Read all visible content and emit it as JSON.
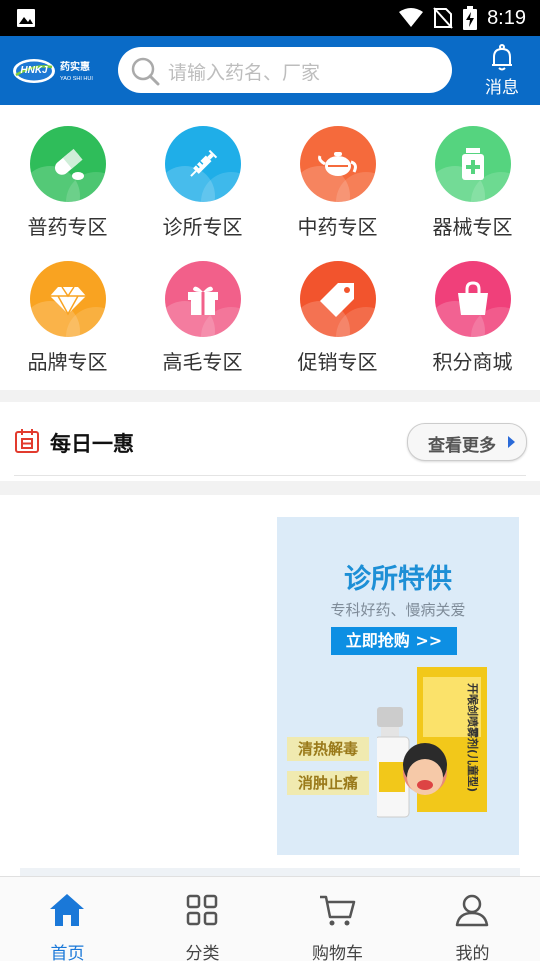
{
  "status_bar": {
    "time": "8:19",
    "icons": [
      "image-icon",
      "wifi-icon",
      "no-sim-icon",
      "battery-charging-icon"
    ]
  },
  "header": {
    "logo_text": "HNKJ",
    "logo_cn": "药实惠",
    "logo_en": "YAO SHI HUI",
    "search_placeholder": "请输入药名、厂家",
    "message_label": "消息",
    "accent_color": "#0a6bc7"
  },
  "categories": [
    {
      "label": "普药专区",
      "icon": "pill-icon",
      "color": "#2fbd5a"
    },
    {
      "label": "诊所专区",
      "icon": "syringe-icon",
      "color": "#1faee8"
    },
    {
      "label": "中药专区",
      "icon": "teapot-icon",
      "color": "#f56a3c"
    },
    {
      "label": "器械专区",
      "icon": "medicine-bottle-icon",
      "color": "#55d47f"
    },
    {
      "label": "品牌专区",
      "icon": "diamond-icon",
      "color": "#f9a321"
    },
    {
      "label": "高毛专区",
      "icon": "gift-icon",
      "color": "#f2608a"
    },
    {
      "label": "促销专区",
      "icon": "price-tag-icon",
      "color": "#f2542d"
    },
    {
      "label": "积分商城",
      "icon": "shopping-bag-icon",
      "color": "#f0407a"
    }
  ],
  "daily_deal": {
    "title": "每日一惠",
    "more_button": "查看更多"
  },
  "promo": {
    "title": "诊所特供",
    "subtitle": "专科好药、慢病关爱",
    "button": "立即抢购 >>",
    "tag1": "清热解毒",
    "tag2": "消肿止痛",
    "product_text": "开喉剑喷雾剂(儿童型)"
  },
  "bottom_nav": [
    {
      "label": "首页",
      "icon": "home-icon",
      "active": true
    },
    {
      "label": "分类",
      "icon": "grid-icon",
      "active": false
    },
    {
      "label": "购物车",
      "icon": "cart-icon",
      "active": false
    },
    {
      "label": "我的",
      "icon": "user-icon",
      "active": false
    }
  ]
}
